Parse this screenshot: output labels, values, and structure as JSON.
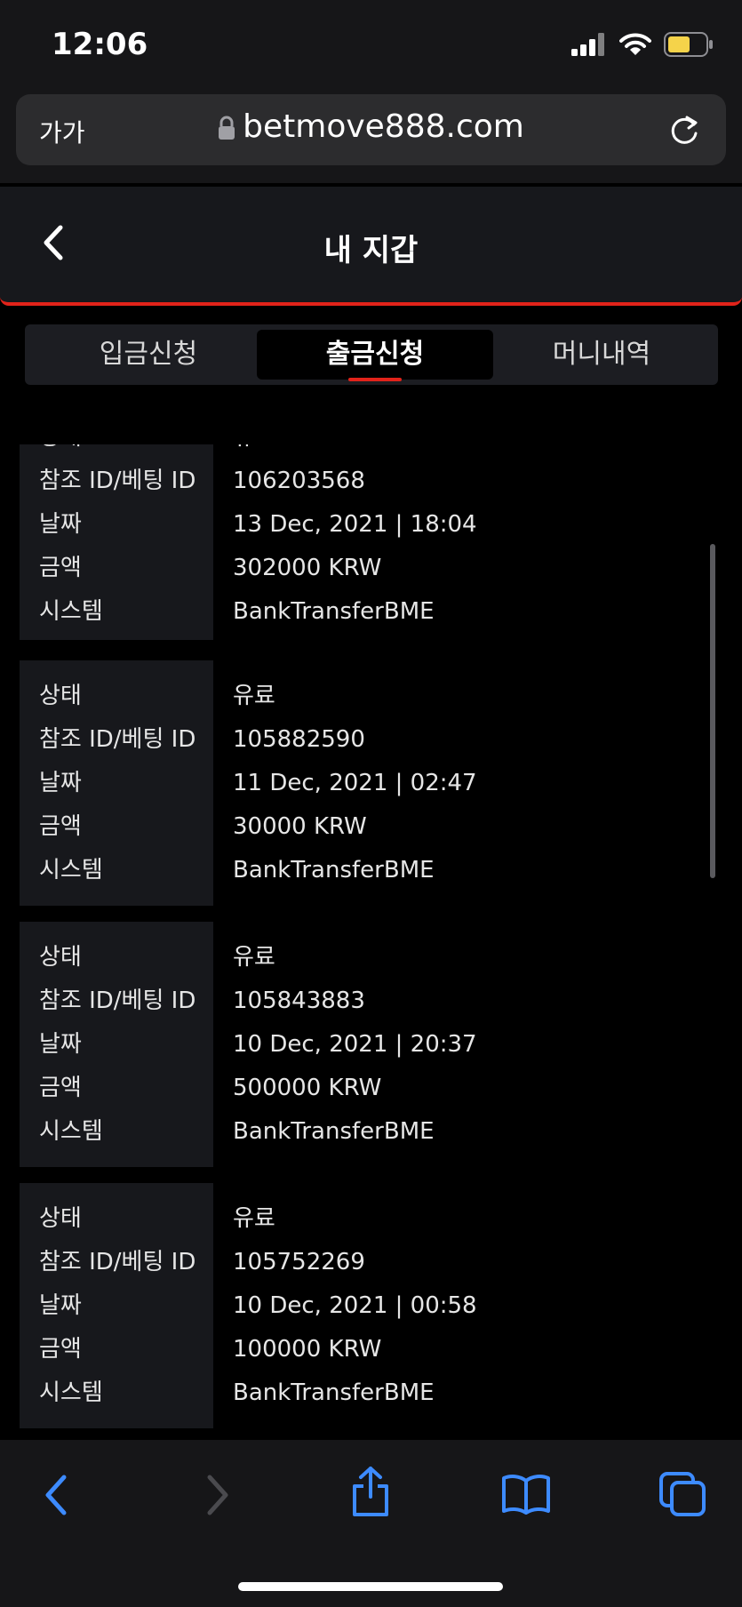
{
  "status": {
    "time": "12:06"
  },
  "browser": {
    "text_size_label": "가가",
    "url": "betmove888.com"
  },
  "header": {
    "title": "내 지갑"
  },
  "tabs": [
    {
      "label": "입금신청",
      "active": false
    },
    {
      "label": "출금신청",
      "active": true
    },
    {
      "label": "머니내역",
      "active": false
    }
  ],
  "labels": {
    "status": "상태",
    "ref_id": "참조 ID/베팅 ID",
    "date": "날짜",
    "amount": "금액",
    "system": "시스템"
  },
  "records": [
    {
      "status": "유료",
      "ref_id": "106203568",
      "date": "13 Dec, 2021 | 18:04",
      "amount": "302000 KRW",
      "system": "BankTransferBME"
    },
    {
      "status": "유료",
      "ref_id": "105882590",
      "date": "11 Dec, 2021 | 02:47",
      "amount": "30000 KRW",
      "system": "BankTransferBME"
    },
    {
      "status": "유료",
      "ref_id": "105843883",
      "date": "10 Dec, 2021 | 20:37",
      "amount": "500000 KRW",
      "system": "BankTransferBME"
    },
    {
      "status": "유료",
      "ref_id": "105752269",
      "date": "10 Dec, 2021 | 00:58",
      "amount": "100000 KRW",
      "system": "BankTransferBME"
    }
  ],
  "colors": {
    "accent": "#e2231a",
    "toolbar_icon": "#3d8bff",
    "battery": "#f5d34a"
  }
}
